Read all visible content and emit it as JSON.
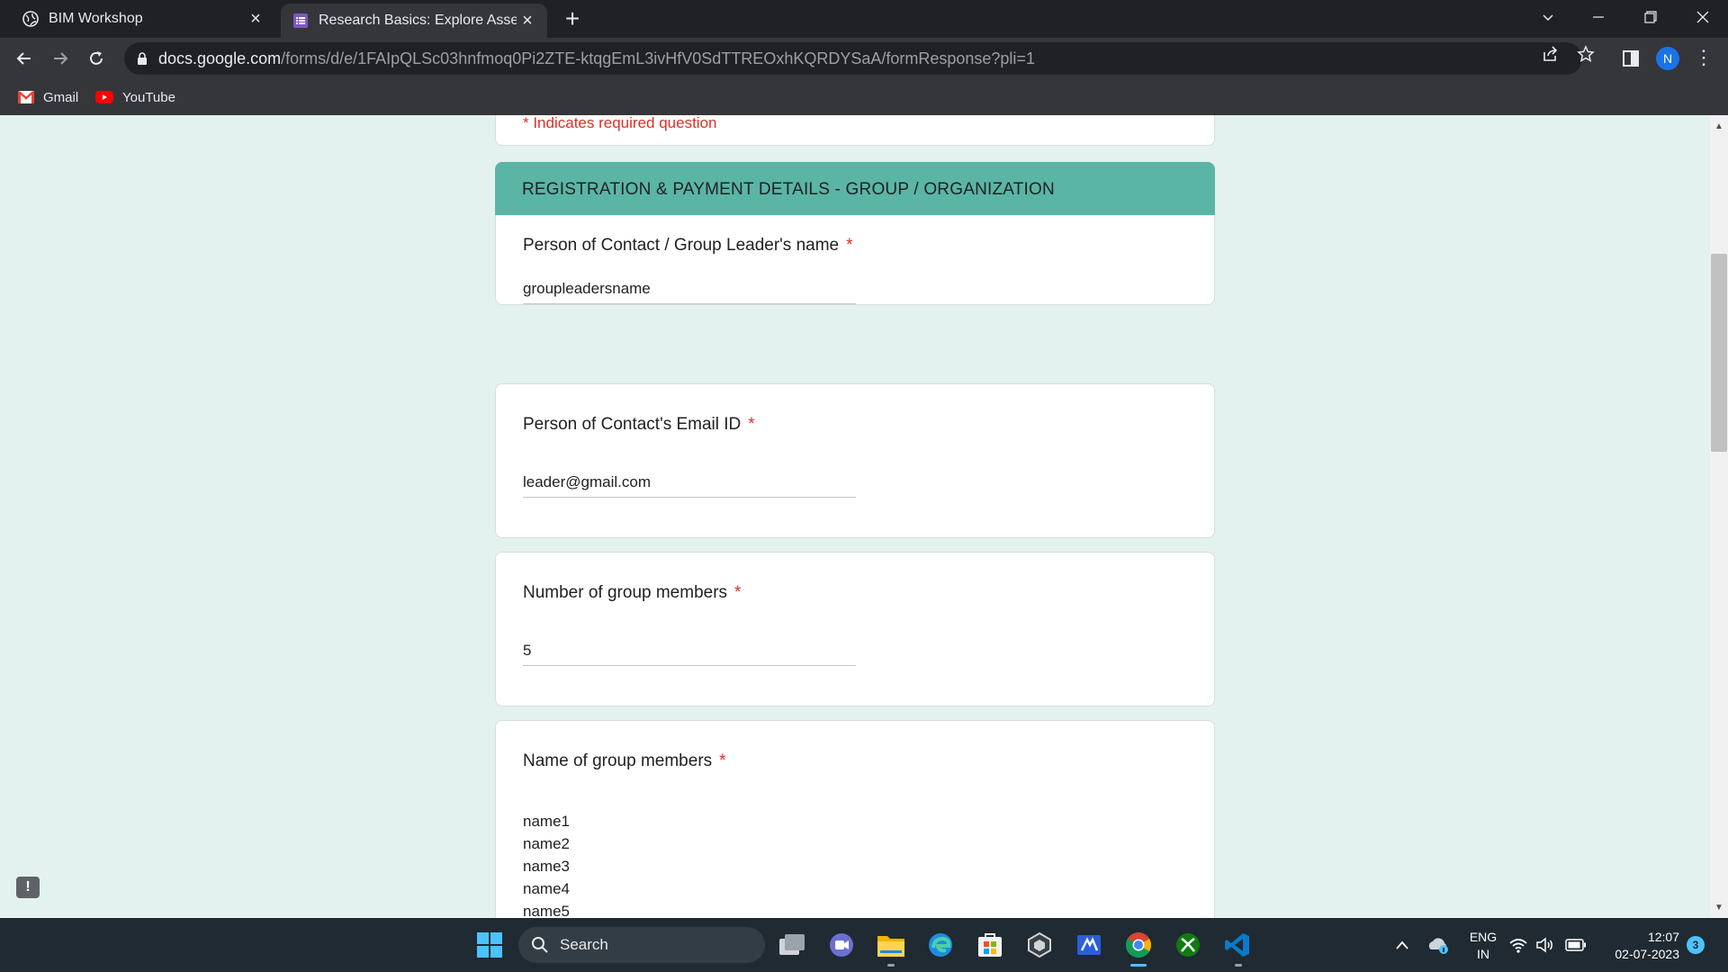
{
  "browser": {
    "tabs": [
      {
        "title": "BIM Workshop"
      },
      {
        "title": "Research Basics: Explore Assess T"
      }
    ],
    "url_host": "docs.google.com",
    "url_path": "/forms/d/e/1FAIpQLSc03hnfmoq0Pi2ZTE-ktqgEmL3ivHfV0SdTTREOxhKQRDYSaA/formResponse?pli=1",
    "profile_initial": "N",
    "bookmarks": [
      {
        "label": "Gmail"
      },
      {
        "label": "YouTube"
      }
    ]
  },
  "form": {
    "required_note": "* Indicates required question",
    "section_title": "REGISTRATION & PAYMENT DETAILS -  GROUP / ORGANIZATION",
    "required_marker": "*",
    "questions": [
      {
        "label": "Person of Contact / Group Leader's name",
        "answer": "groupleadersname"
      },
      {
        "label": "Person of Contact's Email ID",
        "answer": "leader@gmail.com"
      },
      {
        "label": "Number of group members",
        "answer": "5"
      },
      {
        "label": "Name of group members",
        "answer_lines": [
          "name1",
          "name2",
          "name3",
          "name4",
          "name5"
        ]
      }
    ],
    "feedback_label": "!"
  },
  "taskbar": {
    "search_label": "Search",
    "lang_line1": "ENG",
    "lang_line2": "IN",
    "time": "12:07",
    "date": "02-07-2023",
    "notification_count": "3"
  },
  "colors": {
    "section_header": "#5ab5a5",
    "page_bg": "#e3f2ef",
    "required": "#d93025"
  }
}
